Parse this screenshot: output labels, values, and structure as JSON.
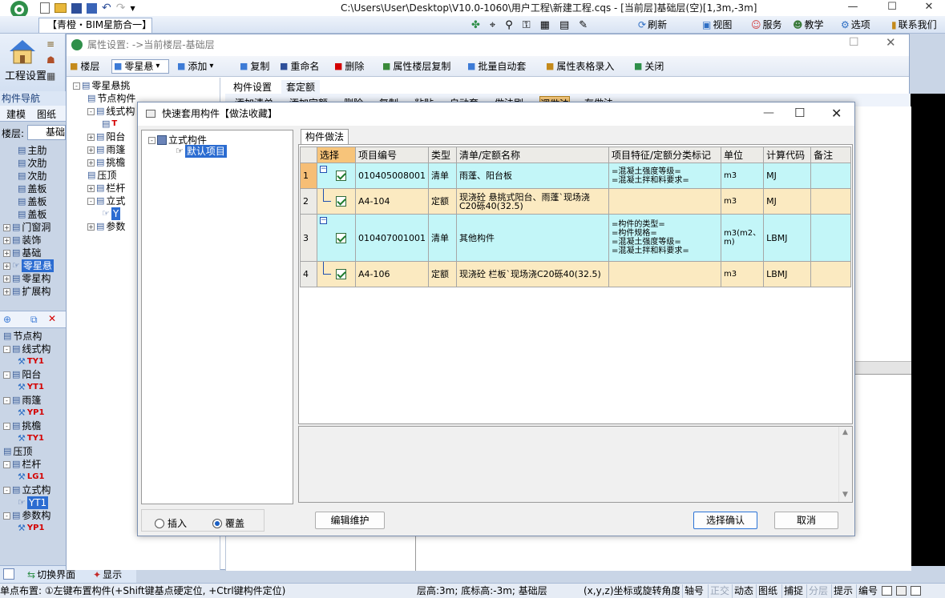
{
  "window": {
    "title": "C:\\Users\\User\\Desktop\\V10.0-1060\\用户工程\\新建工程.cqs - [当前层]基础层(空)[1,3m,-3m]",
    "doc_tab": "【青橙・BIM星筋合一】",
    "controls": {
      "minimize": "—",
      "maximize": "☐",
      "close": "✕"
    }
  },
  "top_toolbar": [
    {
      "label": "刷新",
      "icon": "refresh-icon"
    },
    {
      "label": "视图",
      "icon": "view-icon"
    },
    {
      "label": "服务",
      "icon": "service-icon"
    },
    {
      "label": "教学",
      "icon": "teach-icon"
    },
    {
      "label": "选项",
      "icon": "options-icon"
    },
    {
      "label": "联系我们",
      "icon": "contact-icon"
    }
  ],
  "ribbon": {
    "label": "工程设置"
  },
  "nav": {
    "header": "构件导航",
    "tabs": [
      "建模",
      "图纸"
    ],
    "floor_label": "楼层:",
    "floor_value": "基础"
  },
  "left_tree_top": [
    {
      "label": "主肋",
      "level": 2
    },
    {
      "label": "次肋",
      "level": 2
    },
    {
      "label": "次肋",
      "level": 2
    },
    {
      "label": "盖板",
      "level": 2
    },
    {
      "label": "盖板",
      "level": 2
    },
    {
      "label": "盖板",
      "level": 2
    },
    {
      "label": "门窗洞",
      "level": 1,
      "exp": "+"
    },
    {
      "label": "装饰",
      "level": 1,
      "exp": "+"
    },
    {
      "label": "基础",
      "level": 1,
      "exp": "+"
    },
    {
      "label": "零星悬",
      "level": 1,
      "exp": "+",
      "selected": true
    },
    {
      "label": "零星构",
      "level": 1,
      "exp": "+"
    },
    {
      "label": "扩展构",
      "level": 1,
      "exp": "+"
    }
  ],
  "left_tree_bottom": [
    {
      "label": "节点构",
      "level": 1
    },
    {
      "label": "线式构",
      "level": 1,
      "exp": "-"
    },
    {
      "label": "TY1",
      "level": 2,
      "red": true
    },
    {
      "label": "阳台",
      "level": 1,
      "exp": "-"
    },
    {
      "label": "YT1",
      "level": 2,
      "red": true
    },
    {
      "label": "雨篷",
      "level": 1,
      "exp": "-"
    },
    {
      "label": "YP1",
      "level": 2,
      "red": true
    },
    {
      "label": "挑檐",
      "level": 1,
      "exp": "-"
    },
    {
      "label": "TY1",
      "level": 2,
      "red": true
    },
    {
      "label": "压顶",
      "level": 1
    },
    {
      "label": "栏杆",
      "level": 1,
      "exp": "-"
    },
    {
      "label": "LG1",
      "level": 2,
      "red": true
    },
    {
      "label": "立式构",
      "level": 1,
      "exp": "-"
    },
    {
      "label": "YT1",
      "level": 2,
      "selected": true
    },
    {
      "label": "参数构",
      "level": 1,
      "exp": "-"
    },
    {
      "label": "YP1",
      "level": 2,
      "red": true
    }
  ],
  "bottom_tabs": [
    "切换界面",
    "显示"
  ],
  "statusbar": {
    "hint": "单点布置: ①左键布置构件(+Shift键基点硬定位, +Ctrl键构件定位)",
    "floor_info": "层高:3m; 底标高:-3m; 基础层",
    "coord": "(x,y,z)坐标或旋转角度",
    "buttons": [
      "轴号",
      "正交",
      "动态",
      "图纸",
      "捕捉",
      "分层",
      "提示",
      "编号"
    ]
  },
  "prop_window": {
    "title": "属性设置: ->当前楼层-基础层",
    "toolbar": [
      {
        "label": "楼层",
        "icon": "floor-icon"
      },
      {
        "label": "零星悬",
        "icon": "component-icon",
        "dropdown": true
      },
      {
        "label": "添加",
        "icon": "add-icon",
        "dropdown": true
      },
      {
        "label": "复制",
        "icon": "copy-icon"
      },
      {
        "label": "重命名",
        "icon": "rename-icon"
      },
      {
        "label": "删除",
        "icon": "delete-icon"
      },
      {
        "label": "属性楼层复制",
        "icon": "floor-copy-icon"
      },
      {
        "label": "批量自动套",
        "icon": "batch-icon"
      },
      {
        "label": "属性表格录入",
        "icon": "table-input-icon"
      },
      {
        "label": "关闭",
        "icon": "close-check-icon"
      }
    ],
    "tree": [
      {
        "label": "零星悬挑",
        "level": 0,
        "exp": "-"
      },
      {
        "label": "节点构件",
        "level": 1
      },
      {
        "label": "线式构",
        "level": 1,
        "exp": "-"
      },
      {
        "label": "T",
        "level": 2,
        "red": true
      },
      {
        "label": "阳台",
        "level": 1,
        "exp": "+"
      },
      {
        "label": "雨篷",
        "level": 1,
        "exp": "+"
      },
      {
        "label": "挑檐",
        "level": 1,
        "exp": "+"
      },
      {
        "label": "压顶",
        "level": 1
      },
      {
        "label": "栏杆",
        "level": 1,
        "exp": "+"
      },
      {
        "label": "立式",
        "level": 1,
        "exp": "-"
      },
      {
        "label": "Y",
        "level": 2,
        "selected": true
      },
      {
        "label": "参数",
        "level": 1,
        "exp": "+"
      }
    ],
    "tabs": [
      "构件设置",
      "套定额"
    ],
    "subtoolbar": [
      "添加清单",
      "添加定额",
      "删除",
      "复制",
      "粘贴",
      "自动套",
      "做法刷",
      "调做法",
      "存做法"
    ]
  },
  "dialog": {
    "title": "快速套用构件【做法收藏】",
    "tree": [
      {
        "label": "立式构件",
        "level": 0,
        "exp": "-"
      },
      {
        "label": "默认项目",
        "level": 1,
        "selected": true
      }
    ],
    "grid_tab": "构件做法",
    "columns": [
      "选择",
      "项目编号",
      "类型",
      "清单/定额名称",
      "项目特征/定额分类标记",
      "单位",
      "计算代码",
      "备注"
    ],
    "rows": [
      {
        "no": "1",
        "code": "010405008001",
        "type": "清单",
        "name": "雨蓬、阳台板",
        "feature": [
          "=混凝土强度等级=",
          "=混凝土拌和料要求="
        ],
        "unit": "m3",
        "calc": "MJ",
        "note": "",
        "style": "cyan"
      },
      {
        "no": "2",
        "code": "A4-104",
        "type": "定额",
        "name": "现浇砼 悬挑式阳台、雨蓬`现场浇C20砾40(32.5)",
        "feature": [],
        "unit": "m3",
        "calc": "MJ",
        "note": "",
        "style": "tan"
      },
      {
        "no": "3",
        "code": "010407001001",
        "type": "清单",
        "name": "其他构件",
        "feature": [
          "=构件的类型=",
          "=构件规格=",
          "=混凝土强度等级=",
          "=混凝土拌和料要求="
        ],
        "unit": "m3(m2、m)",
        "calc": "LBMJ",
        "note": "",
        "style": "cyan"
      },
      {
        "no": "4",
        "code": "A4-106",
        "type": "定额",
        "name": "现浇砼 栏板`现场浇C20砾40(32.5)",
        "feature": [],
        "unit": "m3",
        "calc": "LBMJ",
        "note": "",
        "style": "tan"
      }
    ],
    "radio": {
      "insert": "插入",
      "overwrite": "覆盖",
      "selected": "overwrite"
    },
    "buttons": {
      "edit": "编辑维护",
      "confirm": "选择确认",
      "cancel": "取消"
    },
    "controls": {
      "minimize": "—",
      "maximize": "☐",
      "close": "✕"
    }
  },
  "colors": {
    "row_cyan": "#c3f6f8",
    "row_tan": "#fbeac1",
    "header_select": "#f7c47a",
    "selection_blue": "#2b6cd1"
  }
}
